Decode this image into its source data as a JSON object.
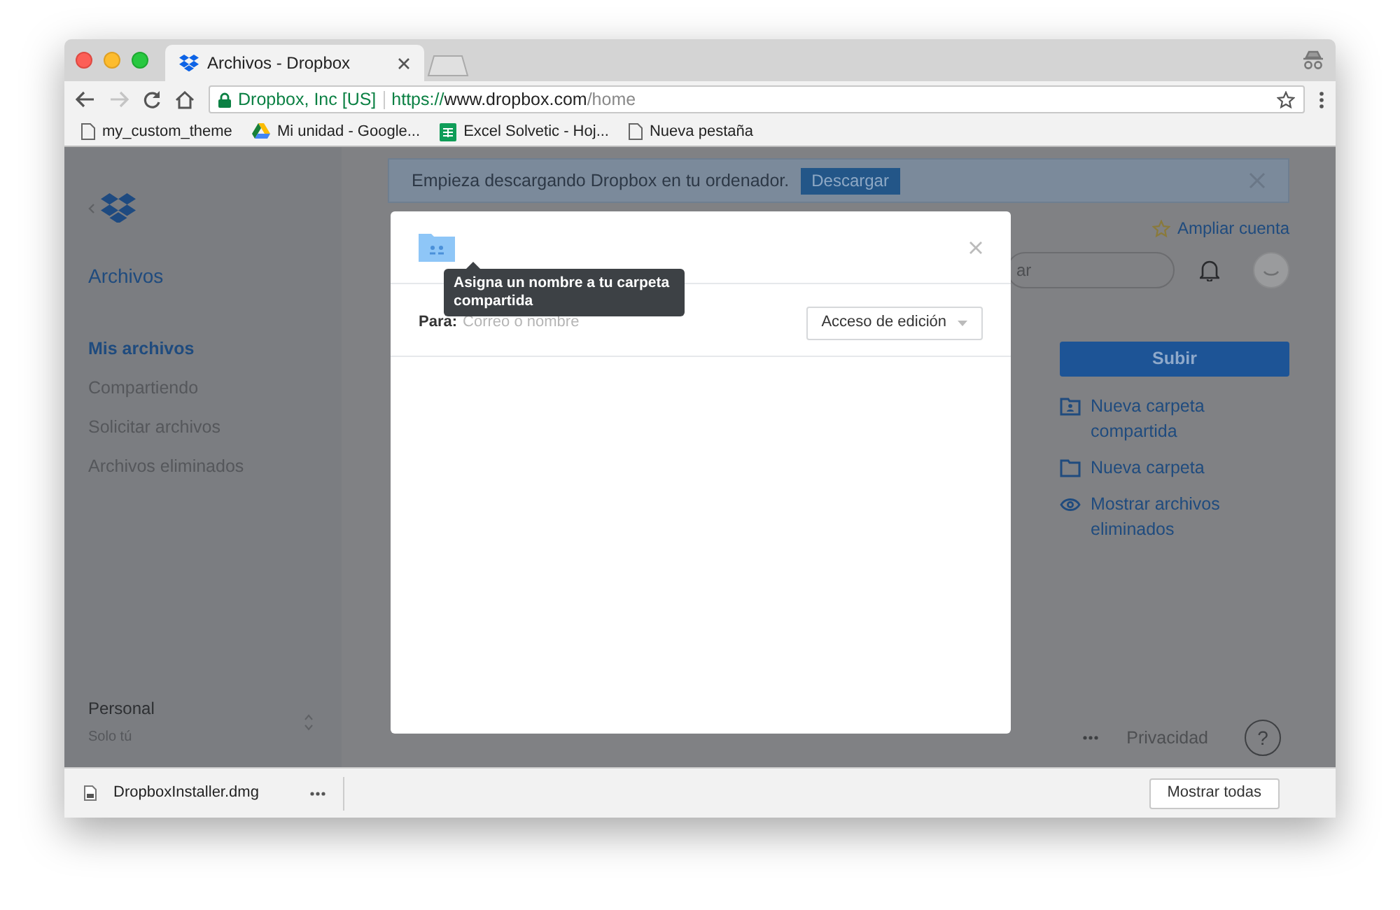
{
  "tab": {
    "title": "Archivos - Dropbox",
    "selected": true
  },
  "address": {
    "site": "Dropbox, Inc [US]",
    "scheme": "https://",
    "host": "www.dropbox.com",
    "path": "/home"
  },
  "bookmarks": [
    {
      "label": "my_custom_theme",
      "kind": "page"
    },
    {
      "label": "Mi unidad - Google...",
      "kind": "drive"
    },
    {
      "label": "Excel Solvetic - Hoj...",
      "kind": "sheet"
    },
    {
      "label": "Nueva pestaña",
      "kind": "page"
    }
  ],
  "sidebar": {
    "title": "Archivos",
    "items": [
      {
        "label": "Mis archivos",
        "selected": true
      },
      {
        "label": "Compartiendo",
        "selected": false
      },
      {
        "label": "Solicitar archivos",
        "selected": false
      },
      {
        "label": "Archivos eliminados",
        "selected": false
      }
    ],
    "account": {
      "name": "Personal",
      "subtitle": "Solo tú"
    }
  },
  "banner": {
    "text": "Empieza descargando Dropbox en tu ordenador.",
    "button": "Descargar"
  },
  "upgrade": "Ampliar cuenta",
  "search": {
    "placeholder": "ar"
  },
  "upload_button": "Subir",
  "actions": [
    {
      "label": "Nueva carpeta compartida",
      "kind": "shared-folder"
    },
    {
      "label": "Nueva carpeta",
      "kind": "folder"
    },
    {
      "label": "Mostrar archivos eliminados",
      "kind": "eye"
    }
  ],
  "footer": {
    "privacy": "Privacidad",
    "help": "?"
  },
  "dialog": {
    "tooltip": "Asigna un nombre a tu carpeta compartida",
    "to_label": "Para:",
    "to_placeholder": "Correo o nombre",
    "access": "Acceso de edición"
  },
  "downloads": {
    "file": "DropboxInstaller.dmg",
    "show_all": "Mostrar todas"
  }
}
